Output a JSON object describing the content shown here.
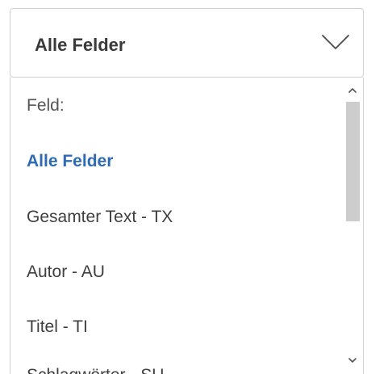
{
  "select": {
    "value": "Alle Felder",
    "icon": "chevron-down-icon"
  },
  "dropdown": {
    "group_label": "Feld:",
    "options": [
      {
        "label": "Alle Felder",
        "selected": true
      },
      {
        "label": "Gesamter Text - TX",
        "selected": false
      },
      {
        "label": "Autor - AU",
        "selected": false
      },
      {
        "label": "Titel - TI",
        "selected": false
      },
      {
        "label": "Schlagwörter - SU",
        "selected": false
      }
    ]
  },
  "colors": {
    "selected_text": "#2f6bb3",
    "text": "#3f3f3f",
    "border": "#cfcfcf",
    "scroll_thumb": "#cdcdcd"
  }
}
